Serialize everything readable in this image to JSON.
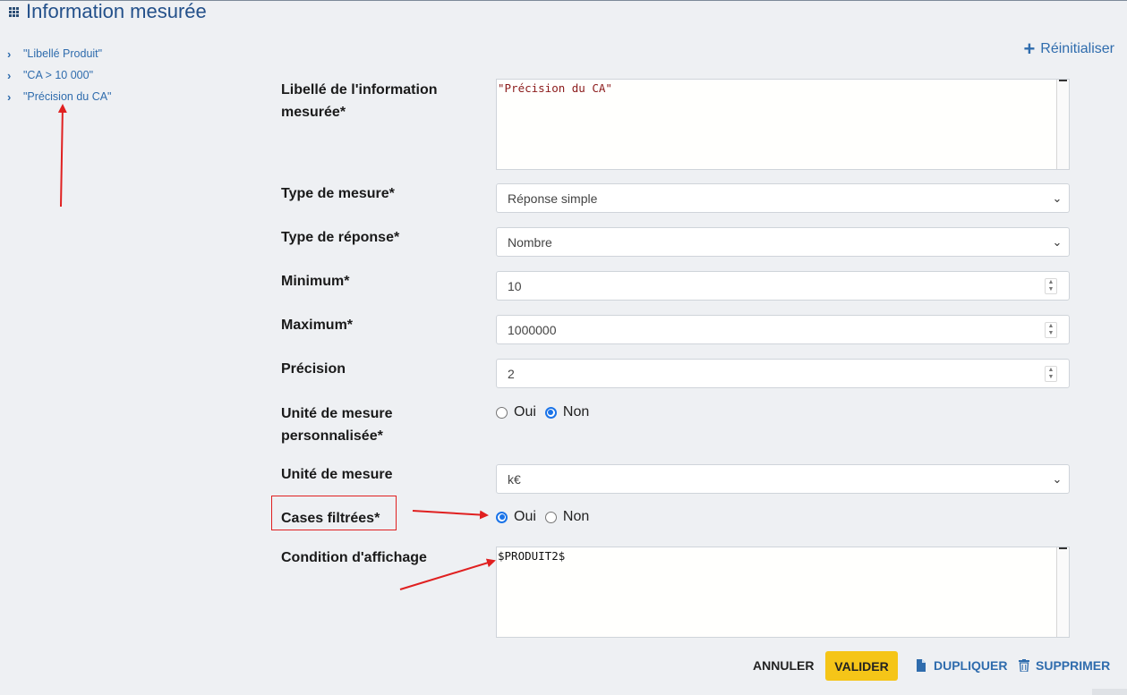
{
  "header": {
    "title": "Information mesurée",
    "icon": "grid-icon"
  },
  "tree": {
    "items": [
      "\"Libellé Produit\"",
      "\"CA > 10 000\"",
      "\"Précision du CA\""
    ]
  },
  "reset_label": "Réinitialiser",
  "form": {
    "libelle": {
      "label": "Libellé de l'information mesurée*",
      "value": "\"Précision du CA\"",
      "value_color": "#8b1a1a"
    },
    "type_mesure": {
      "label": "Type de mesure*",
      "value": "Réponse simple"
    },
    "type_reponse": {
      "label": "Type de réponse*",
      "value": "Nombre"
    },
    "minimum": {
      "label": "Minimum*",
      "value": "10"
    },
    "maximum": {
      "label": "Maximum*",
      "value": "1000000"
    },
    "precision": {
      "label": "Précision",
      "value": "2"
    },
    "unite_perso": {
      "label": "Unité de mesure personnalisée*",
      "options": [
        "Oui",
        "Non"
      ],
      "selected": "Non"
    },
    "unite": {
      "label": "Unité de mesure",
      "value": "k€"
    },
    "cases_filtrees": {
      "label": "Cases filtrées*",
      "options": [
        "Oui",
        "Non"
      ],
      "selected": "Oui"
    },
    "condition": {
      "label": "Condition d'affichage",
      "value": "$PRODUIT2$"
    }
  },
  "actions": {
    "annuler": "ANNULER",
    "valider": "VALIDER",
    "dupliquer": "DUPLIQUER",
    "supprimer": "SUPPRIMER"
  },
  "colors": {
    "accent": "#2f6cad",
    "primary_button": "#f5c518",
    "annotation": "#e02020",
    "radio_checked": "#1a73e8"
  }
}
